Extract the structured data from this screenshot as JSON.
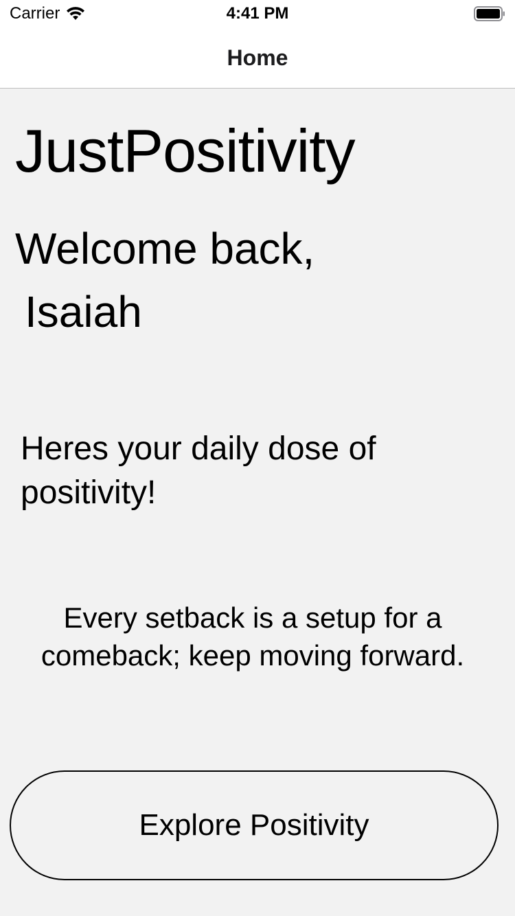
{
  "status_bar": {
    "carrier": "Carrier",
    "time": "4:41 PM",
    "wifi_icon": "wifi-icon",
    "battery_icon": "battery-full-icon"
  },
  "nav": {
    "title": "Home"
  },
  "main": {
    "app_title": "JustPositivity",
    "welcome": "Welcome back,",
    "user_name": "Isaiah",
    "daily_dose": "Heres your daily dose of positivity!",
    "quote": "Every setback is a setup for a comeback; keep moving forward.",
    "explore_button_label": "Explore Positivity"
  }
}
